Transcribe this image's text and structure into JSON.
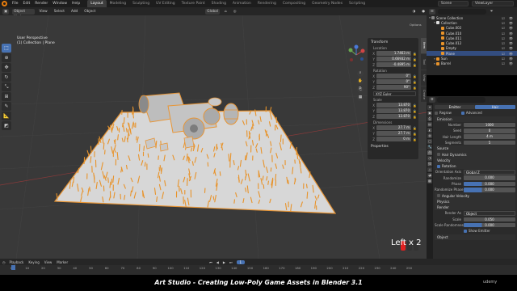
{
  "topbar": {
    "menus": [
      "File",
      "Edit",
      "Render",
      "Window",
      "Help"
    ],
    "workspaces": [
      "Layout",
      "Modeling",
      "Sculpting",
      "UV Editing",
      "Texture Paint",
      "Shading",
      "Animation",
      "Rendering",
      "Compositing",
      "Geometry Nodes",
      "Scripting"
    ],
    "active_workspace": "Layout",
    "scene": "Scene",
    "view_layer": "ViewLayer"
  },
  "viewport_header": {
    "mode": "Object Mode",
    "menus": [
      "View",
      "Select",
      "Add",
      "Object"
    ],
    "orientation": "Global"
  },
  "viewport": {
    "view_name": "User Perspective",
    "collection_path": "(1) Collection | Plane",
    "tools": [
      "cursor",
      "select",
      "move",
      "rotate",
      "scale",
      "transform",
      "annotate",
      "measure",
      "add-cube"
    ],
    "overlay_key": "Left x 2"
  },
  "npanel": {
    "section_transform": "Transform",
    "location_label": "Location",
    "location": [
      {
        "axis": "X",
        "value": "1.7463 m"
      },
      {
        "axis": "Y",
        "value": "0.66932 m"
      },
      {
        "axis": "Z",
        "value": "-0.4895 m"
      }
    ],
    "rotation_label": "Rotation",
    "rotation": [
      {
        "axis": "X",
        "value": "0°"
      },
      {
        "axis": "Y",
        "value": "0°"
      },
      {
        "axis": "Z",
        "value": "90°"
      }
    ],
    "rotation_mode": "XYZ Euler",
    "scale_label": "Scale",
    "scale": [
      {
        "axis": "X",
        "value": "13.870"
      },
      {
        "axis": "Y",
        "value": "13.870"
      },
      {
        "axis": "Z",
        "value": "13.870"
      }
    ],
    "dimensions_label": "Dimensions",
    "dimensions": [
      {
        "axis": "X",
        "value": "27.7 m"
      },
      {
        "axis": "Y",
        "value": "27.7 m"
      },
      {
        "axis": "Z",
        "value": "0 m"
      }
    ],
    "section_properties": "Properties",
    "tabs": [
      "Item",
      "Tool",
      "View",
      "Create"
    ],
    "options_label": "Options"
  },
  "outliner": {
    "search_placeholder": "",
    "rows": [
      {
        "name": "Scene Collection",
        "indent": 0,
        "color": "#888888",
        "selected": false
      },
      {
        "name": "Collection",
        "indent": 1,
        "color": "#dddddd",
        "selected": false
      },
      {
        "name": "Cube.002",
        "indent": 2,
        "color": "#e8932a",
        "selected": false
      },
      {
        "name": "Cube.010",
        "indent": 2,
        "color": "#e8932a",
        "selected": false
      },
      {
        "name": "Cube.011",
        "indent": 2,
        "color": "#e8932a",
        "selected": false
      },
      {
        "name": "Cube.012",
        "indent": 2,
        "color": "#e8932a",
        "selected": false
      },
      {
        "name": "Empty",
        "indent": 2,
        "color": "#e8932a",
        "selected": false
      },
      {
        "name": "Plane",
        "indent": 2,
        "color": "#e8932a",
        "selected": true
      },
      {
        "name": "Sun",
        "indent": 1,
        "color": "#e8932a",
        "selected": false
      },
      {
        "name": "Barrel",
        "indent": 1,
        "color": "#e8932a",
        "selected": false
      }
    ]
  },
  "properties": {
    "tabs_top": [
      "Emitter",
      "Hair"
    ],
    "active_tab": "Hair",
    "regrow": "Regrow",
    "advanced": "Advanced",
    "emission_label": "Emission",
    "emission": [
      {
        "label": "Number",
        "value": "1000"
      },
      {
        "label": "Seed",
        "value": "0"
      },
      {
        "label": "Hair Length",
        "value": "4 m"
      },
      {
        "label": "Segments",
        "value": "5"
      }
    ],
    "source_label": "Source",
    "hair_dynamics": "Hair Dynamics",
    "velocity_label": "Velocity",
    "rotation_label": "Rotation",
    "orientation_axis_label": "Orientation Axis",
    "orientation_axis_value": "Global Z",
    "rotation_fields": [
      {
        "label": "Randomize",
        "value": "0.000"
      },
      {
        "label": "Phase",
        "value": "0.000"
      },
      {
        "label": "Randomize Phase",
        "value": "0.000"
      }
    ],
    "angular_velocity": "Angular Velocity",
    "physics_label": "Physics",
    "render_label": "Render",
    "render_as_label": "Render As",
    "render_as_value": "Object",
    "scale_label": "Scale",
    "scale_value": "0.050",
    "scale_random_label": "Scale Randomness",
    "scale_random_value": "0.000",
    "show_emitter": "Show Emitter",
    "object_label": "Object"
  },
  "timeline": {
    "menus": [
      "Playback",
      "Keying",
      "View",
      "Marker"
    ],
    "current_frame": "1",
    "ticks": [
      "0",
      "10",
      "20",
      "30",
      "40",
      "50",
      "60",
      "70",
      "80",
      "90",
      "100",
      "110",
      "120",
      "130",
      "140",
      "150",
      "160",
      "170",
      "180",
      "190",
      "200",
      "210",
      "220",
      "230",
      "240",
      "250"
    ]
  },
  "caption": {
    "title": "Art Studio - Creating Low-Poly Game Assets in Blender 3.1",
    "brand": "udemy"
  },
  "colors": {
    "accent": "#4772b3",
    "selection_orange": "#e8932a",
    "viewport_bg": "#393939"
  }
}
